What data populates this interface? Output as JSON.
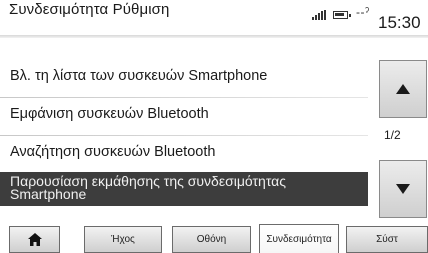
{
  "header": {
    "title": "Συνδεσιμότητα Ρύθμιση",
    "network_indicator": "--ˀ",
    "time": "15:30"
  },
  "menu": {
    "items": [
      {
        "label": "Βλ. τη λίστα των συσκευών Smartphone"
      },
      {
        "label": "Εμφάνιση συσκευών Bluetooth"
      },
      {
        "label": "Αναζήτηση συσκευών Bluetooth"
      },
      {
        "label": "Παρουσίαση εκμάθησης της συνδεσιμότητας Smartphone",
        "selected": true
      }
    ]
  },
  "scroll": {
    "page_indicator": "1/2",
    "up_icon": "arrow-up-icon",
    "down_icon": "arrow-down-icon"
  },
  "tabs": [
    {
      "icon": "home-icon"
    },
    {
      "label": "Ήχος"
    },
    {
      "label": "Οθόνη"
    },
    {
      "label": "Συνδεσιμότητα",
      "active": true
    },
    {
      "label": "Σύστ"
    }
  ],
  "colors": {
    "selected_row": "#3d3d3d",
    "text": "#1a1a1a"
  }
}
